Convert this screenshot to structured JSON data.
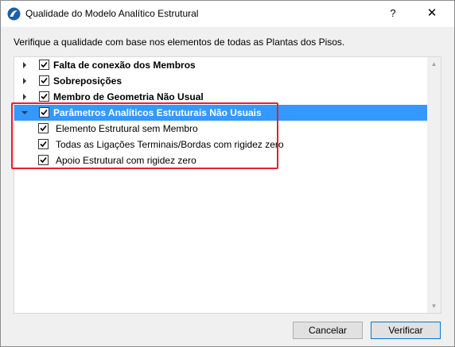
{
  "window": {
    "title": "Qualidade do Modelo Analítico Estrutural",
    "help_label": "?",
    "close_label": "✕"
  },
  "instruction": "Verifique a qualidade com base nos elementos de todas as Plantas dos Pisos.",
  "tree": {
    "items": [
      {
        "label": "Falta de conexão dos Membros",
        "checked": true,
        "expanded": false
      },
      {
        "label": "Sobreposições",
        "checked": true,
        "expanded": false
      },
      {
        "label": "Membro de Geometria Não Usual",
        "checked": true,
        "expanded": false
      },
      {
        "label": "Parâmetros Analíticos Estruturais Não Usuais",
        "checked": true,
        "expanded": true,
        "selected": true,
        "children": [
          {
            "label": "Elemento Estrutural sem Membro",
            "checked": true
          },
          {
            "label": "Todas as Ligações Terminais/Bordas com rigidez zero",
            "checked": true
          },
          {
            "label": "Apoio Estrutural com rigidez zero",
            "checked": true
          }
        ]
      }
    ]
  },
  "buttons": {
    "cancel": "Cancelar",
    "verify": "Verificar"
  },
  "colors": {
    "selection": "#3399ff",
    "highlight_border": "#e8202a"
  }
}
